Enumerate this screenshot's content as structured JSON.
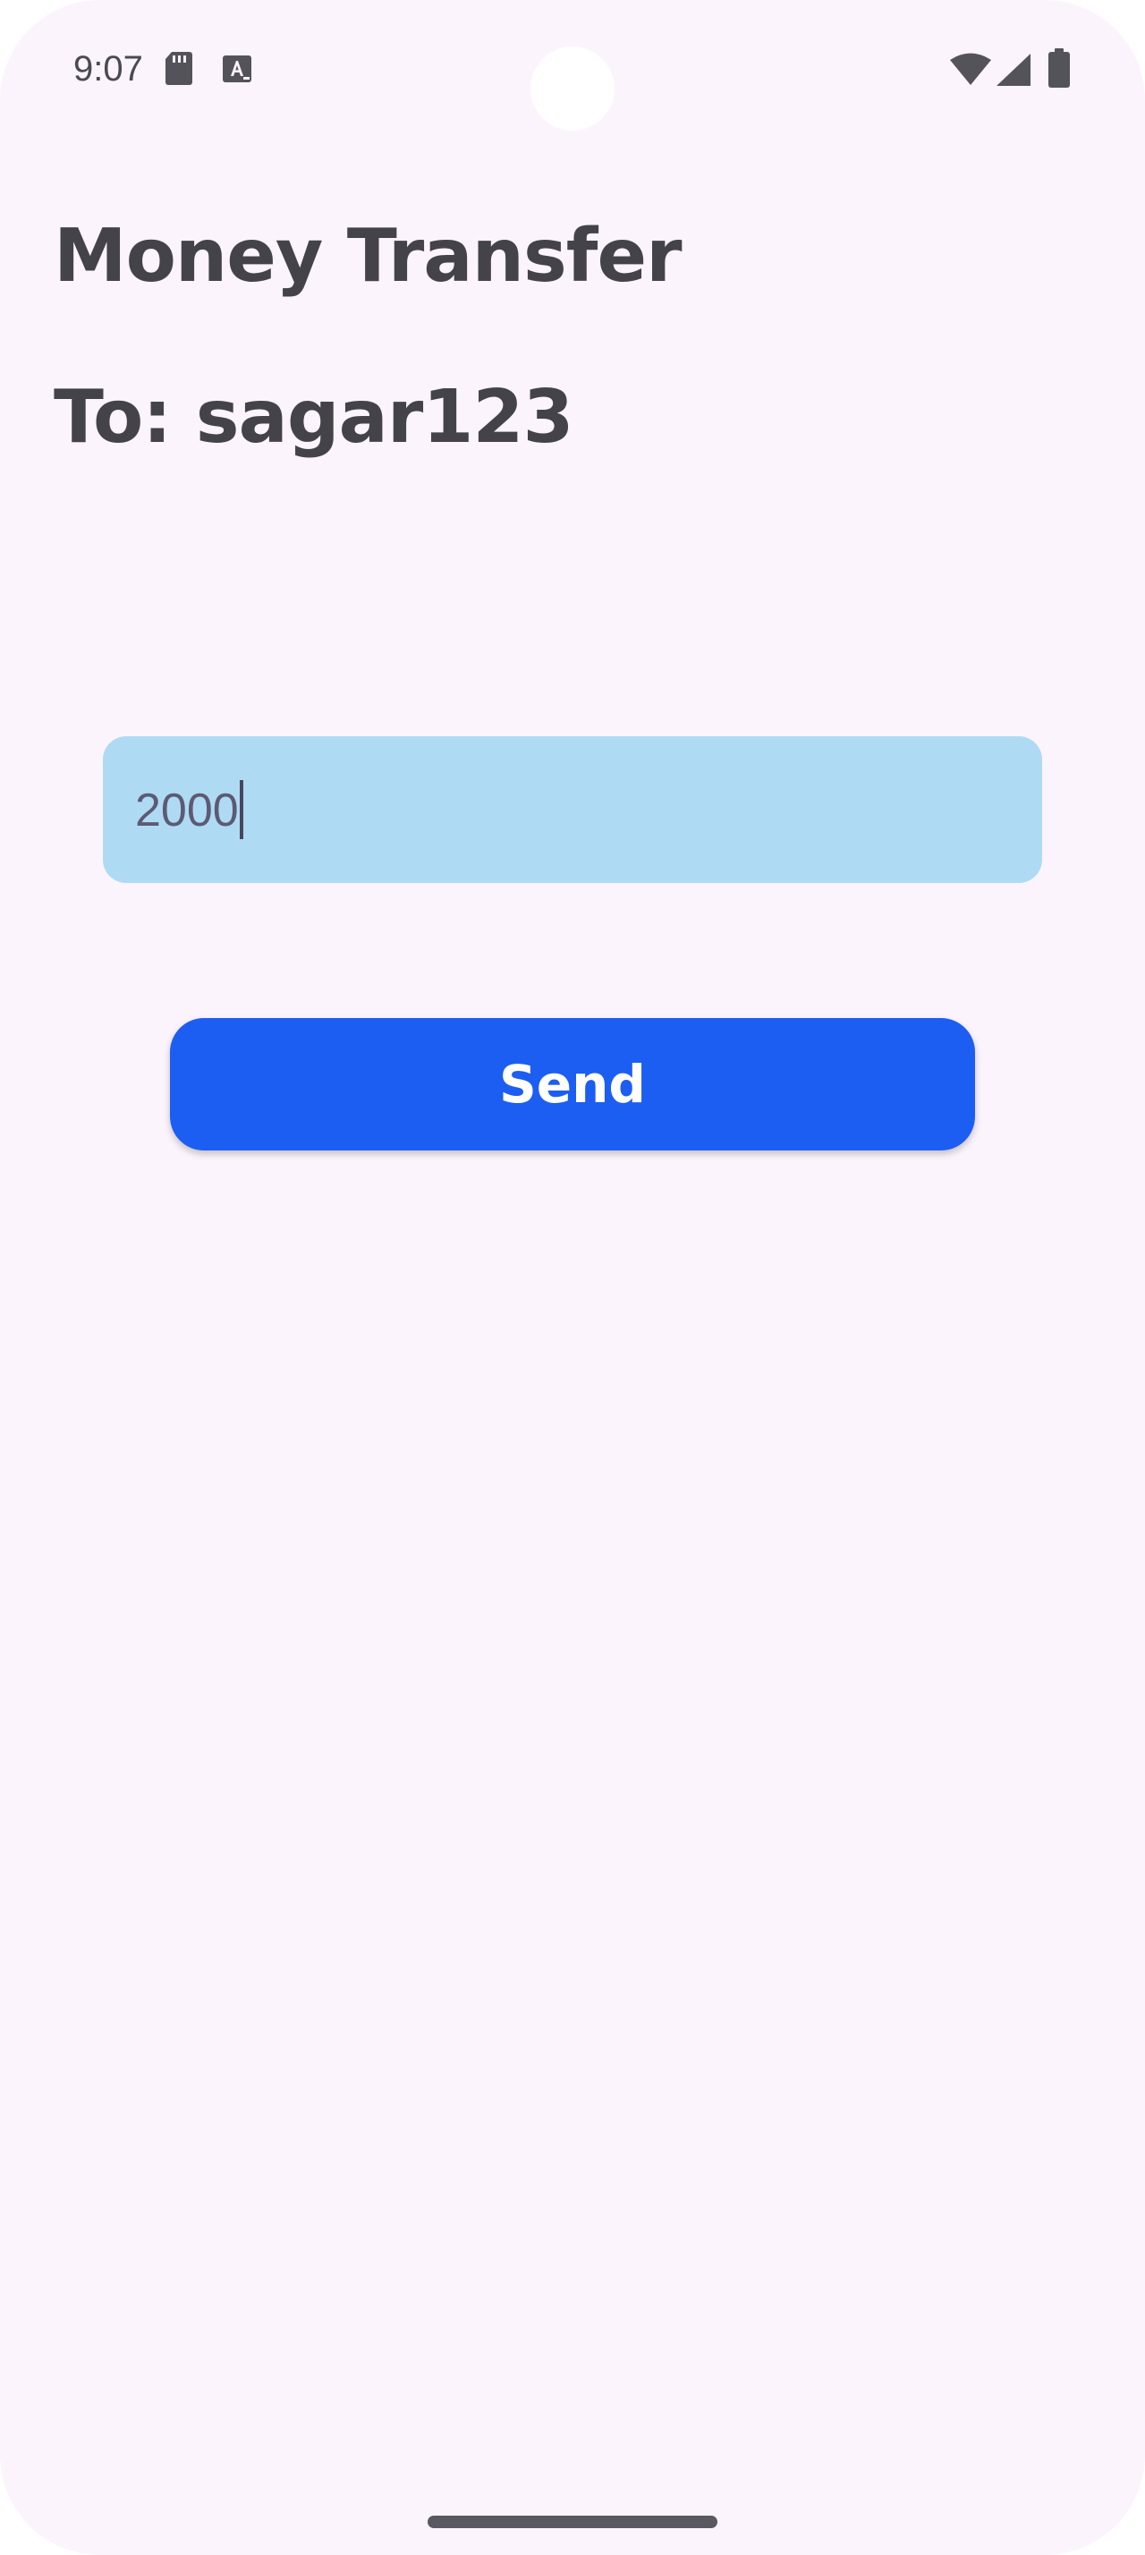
{
  "status_bar": {
    "time": "9:07",
    "icons": [
      "sd-card-icon",
      "font-a-icon",
      "wifi-icon",
      "cell-signal-icon",
      "battery-icon"
    ]
  },
  "header": {
    "title": "Money Transfer",
    "recipient": "To: sagar123"
  },
  "form": {
    "amount_value": "2000",
    "send_label": "Send"
  },
  "colors": {
    "background": "#fcf4fc",
    "field_fill": "#aedbf3",
    "button_fill": "#1c5ef2",
    "text_dark": "#45434a"
  }
}
